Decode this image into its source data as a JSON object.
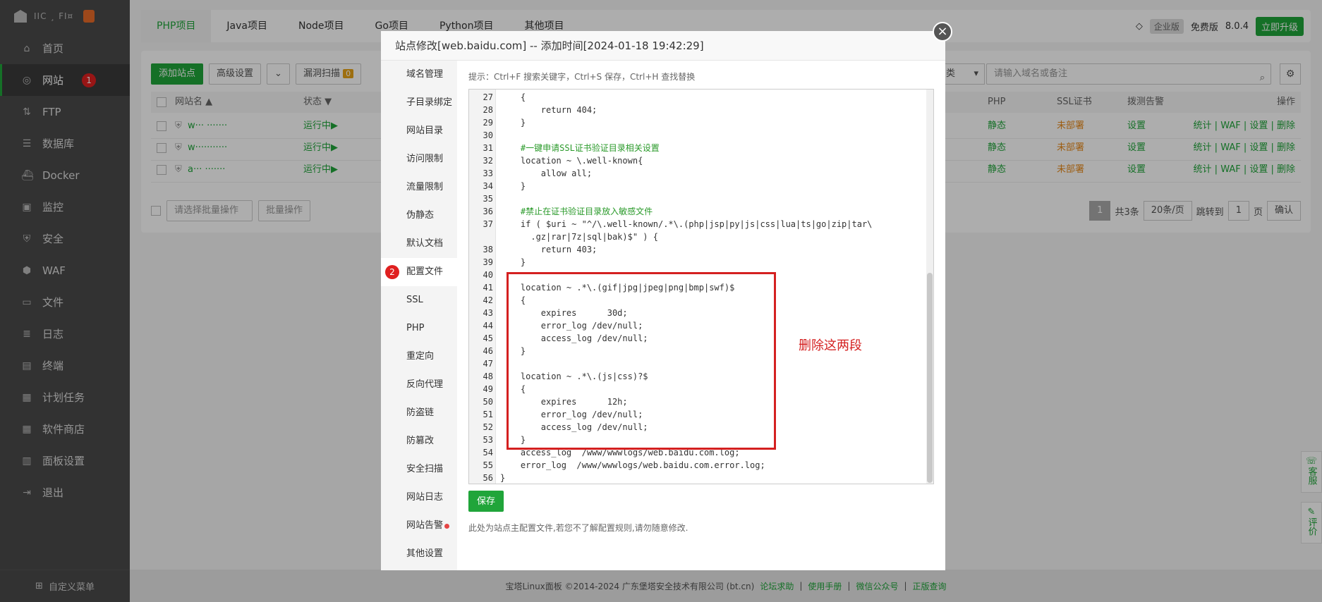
{
  "sidebar": {
    "logo_text": "IIC ¸ FI¤",
    "items": [
      {
        "label": "首页",
        "icon": "home-icon"
      },
      {
        "label": "网站",
        "icon": "globe-icon",
        "badge": "1"
      },
      {
        "label": "FTP",
        "icon": "ftp-icon"
      },
      {
        "label": "数据库",
        "icon": "database-icon"
      },
      {
        "label": "Docker",
        "icon": "docker-icon"
      },
      {
        "label": "监控",
        "icon": "monitor-icon"
      },
      {
        "label": "安全",
        "icon": "shield-icon"
      },
      {
        "label": "WAF",
        "icon": "waf-icon"
      },
      {
        "label": "文件",
        "icon": "folder-icon"
      },
      {
        "label": "日志",
        "icon": "log-icon"
      },
      {
        "label": "终端",
        "icon": "terminal-icon"
      },
      {
        "label": "计划任务",
        "icon": "calendar-icon"
      },
      {
        "label": "软件商店",
        "icon": "apps-icon"
      },
      {
        "label": "面板设置",
        "icon": "settings-icon"
      },
      {
        "label": "退出",
        "icon": "logout-icon"
      }
    ],
    "footer": "自定义菜单"
  },
  "tabs": [
    "PHP项目",
    "Java项目",
    "Node项目",
    "Go项目",
    "Python项目",
    "其他项目"
  ],
  "topright": {
    "enterprise": "企业版",
    "free": "免费版",
    "version": "8.0.4",
    "upgrade": "立即升级"
  },
  "toolbar": {
    "add_site": "添加站点",
    "advanced": "高级设置",
    "vuln_scan": "漏洞扫描",
    "vuln_count": "0",
    "category": "类",
    "search_placeholder": "请输入域名或备注"
  },
  "table": {
    "headers": {
      "name": "网站名 ▲",
      "status": "状态 ▼",
      "php": "PHP",
      "ssl": "SSL证书",
      "alert": "拨测告警",
      "ops": "操作"
    },
    "rows": [
      {
        "name": "w··· ·······",
        "status": "运行中▶",
        "php": "静态",
        "ssl": "未部署",
        "alert": "设置",
        "ops": "统计 | WAF | 设置 | 删除"
      },
      {
        "name": "w···········",
        "status": "运行中▶",
        "php": "静态",
        "ssl": "未部署",
        "alert": "设置",
        "ops": "统计 | WAF | 设置 | 删除"
      },
      {
        "name": "a··· ·······",
        "status": "运行中▶",
        "php": "静态",
        "ssl": "未部署",
        "alert": "设置",
        "ops": "统计 | WAF | 设置 | 删除"
      }
    ]
  },
  "bulk": {
    "select": "请选择批量操作",
    "apply": "批量操作"
  },
  "pager": {
    "current": "1",
    "total": "共3条",
    "per_page": "20条/页",
    "jump_label": "跳转到",
    "jump_value": "1",
    "page_unit": "页",
    "confirm": "确认"
  },
  "footer": {
    "copyright": "宝塔Linux面板 ©2014-2024 广东堡塔安全技术有限公司 (bt.cn)",
    "links": [
      "论坛求助",
      "使用手册",
      "微信公众号",
      "正版查询"
    ]
  },
  "modal": {
    "title": "站点修改[web.baidu.com] -- 添加时间[2024-01-18 19:42:29]",
    "nav": [
      "域名管理",
      "子目录绑定",
      "网站目录",
      "访问限制",
      "流量限制",
      "伪静态",
      "默认文档",
      "配置文件",
      "SSL",
      "PHP",
      "重定向",
      "反向代理",
      "防盗链",
      "防篡改",
      "安全扫描",
      "网站日志",
      "网站告警",
      "其他设置"
    ],
    "nav_badge": "2",
    "hint": "提示：Ctrl+F 搜索关键字，Ctrl+S 保存，Ctrl+H 查找替换",
    "code": [
      {
        "n": "27",
        "t": "    {"
      },
      {
        "n": "28",
        "t": "        return 404;"
      },
      {
        "n": "29",
        "t": "    }"
      },
      {
        "n": "30",
        "t": ""
      },
      {
        "n": "31",
        "t": "    #一键申请SSL证书验证目录相关设置"
      },
      {
        "n": "32",
        "t": "    location ~ \\.well-known{"
      },
      {
        "n": "33",
        "t": "        allow all;"
      },
      {
        "n": "34",
        "t": "    }"
      },
      {
        "n": "35",
        "t": ""
      },
      {
        "n": "36",
        "t": "    #禁止在证书验证目录放入敏感文件"
      },
      {
        "n": "37",
        "t": "    if ( $uri ~ \"^/\\.well-known/.*\\.(php|jsp|py|js|css|lua|ts|go|zip|tar\\"
      },
      {
        "n": "",
        "t": "      .gz|rar|7z|sql|bak)$\" ) {"
      },
      {
        "n": "38",
        "t": "        return 403;"
      },
      {
        "n": "39",
        "t": "    }"
      },
      {
        "n": "40",
        "t": ""
      },
      {
        "n": "41",
        "t": "    location ~ .*\\.(gif|jpg|jpeg|png|bmp|swf)$"
      },
      {
        "n": "42",
        "t": "    {"
      },
      {
        "n": "43",
        "t": "        expires      30d;"
      },
      {
        "n": "44",
        "t": "        error_log /dev/null;"
      },
      {
        "n": "45",
        "t": "        access_log /dev/null;"
      },
      {
        "n": "46",
        "t": "    }"
      },
      {
        "n": "47",
        "t": ""
      },
      {
        "n": "48",
        "t": "    location ~ .*\\.(js|css)?$"
      },
      {
        "n": "49",
        "t": "    {"
      },
      {
        "n": "50",
        "t": "        expires      12h;"
      },
      {
        "n": "51",
        "t": "        error_log /dev/null;"
      },
      {
        "n": "52",
        "t": "        access_log /dev/null;"
      },
      {
        "n": "53",
        "t": "    }"
      },
      {
        "n": "54",
        "t": "    access_log  /www/wwwlogs/web.baidu.com.log;"
      },
      {
        "n": "55",
        "t": "    error_log  /www/wwwlogs/web.baidu.com.error.log;"
      },
      {
        "n": "56",
        "t": "}"
      }
    ],
    "annotation": "删除这两段",
    "save": "保存",
    "note": "此处为站点主配置文件,若您不了解配置规则,请勿随意修改."
  },
  "float": {
    "service": "客服",
    "review": "评价"
  },
  "colors": {
    "accent": "#20a53a",
    "annotation": "#d42020"
  }
}
